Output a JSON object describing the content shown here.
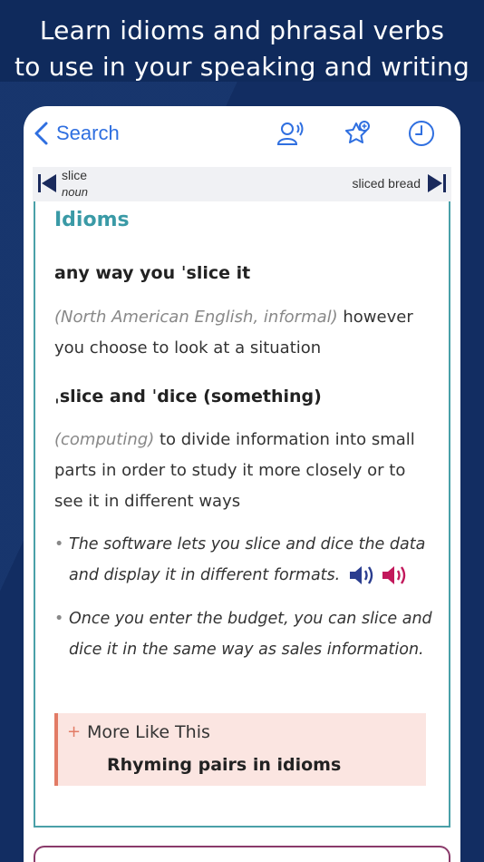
{
  "promo": {
    "line1": "Learn idioms and phrasal verbs",
    "line2": "to use in your speaking and writing"
  },
  "nav": {
    "back_label": "Search",
    "icons": [
      "voice-search-icon",
      "favorites-star-icon",
      "history-clock-icon"
    ]
  },
  "entry_nav": {
    "prev_word": "slice",
    "prev_pos": "noun",
    "next_word": "sliced bread"
  },
  "section": {
    "title": "Idioms",
    "idioms": [
      {
        "phrase": "any way you ˈslice it",
        "label": "(North American English, informal)",
        "definition": " however you choose to look at a situation"
      },
      {
        "phrase": "ˌslice and ˈdice (something)",
        "label": "(computing)",
        "definition": " to divide information into small parts in order to study it more closely or to see it in different ways",
        "examples": [
          "The software lets you slice and dice the data and display it in different formats.",
          "Once you enter the budget, you can slice and dice it in the same way as sales information."
        ]
      }
    ]
  },
  "more_like_this": {
    "label": "More Like This",
    "item": "Rhyming pairs in idioms"
  },
  "colors": {
    "background": "#0f2a5c",
    "accent_blue": "#2f6fe0",
    "teal": "#3a9aa6",
    "speaker_uk": "#2a3d8f",
    "speaker_us": "#c2185b",
    "more_bg": "#fbe5e1",
    "more_border": "#e27b65"
  }
}
